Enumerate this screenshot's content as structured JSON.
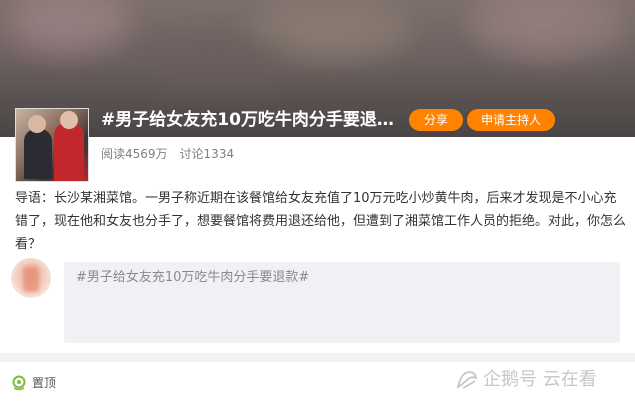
{
  "topic": {
    "title": "#男子给女友充10万吃牛肉分手要退款#",
    "share_label": "分享",
    "host_label": "申请主持人",
    "reads": "阅读4569万",
    "discussions": "讨论1334"
  },
  "intro": "导语：长沙某湘菜馆。一男子称近期在该餐馆给女友充值了10万元吃小炒黄牛肉，后来才发现是不小心充错了，现在他和女友也分手了，想要餐馆将费用退还给他，但遭到了湘菜馆工作人员的拒绝。对此，你怎么看？",
  "comment": {
    "value": "#男子给女友充10万吃牛肉分手要退款#"
  },
  "footer": {
    "pin_label": "置顶"
  },
  "watermark": {
    "text": "企鹅号 云在看"
  },
  "colors": {
    "accent": "#ff8200",
    "pin_icon": "#7cbf3a"
  }
}
